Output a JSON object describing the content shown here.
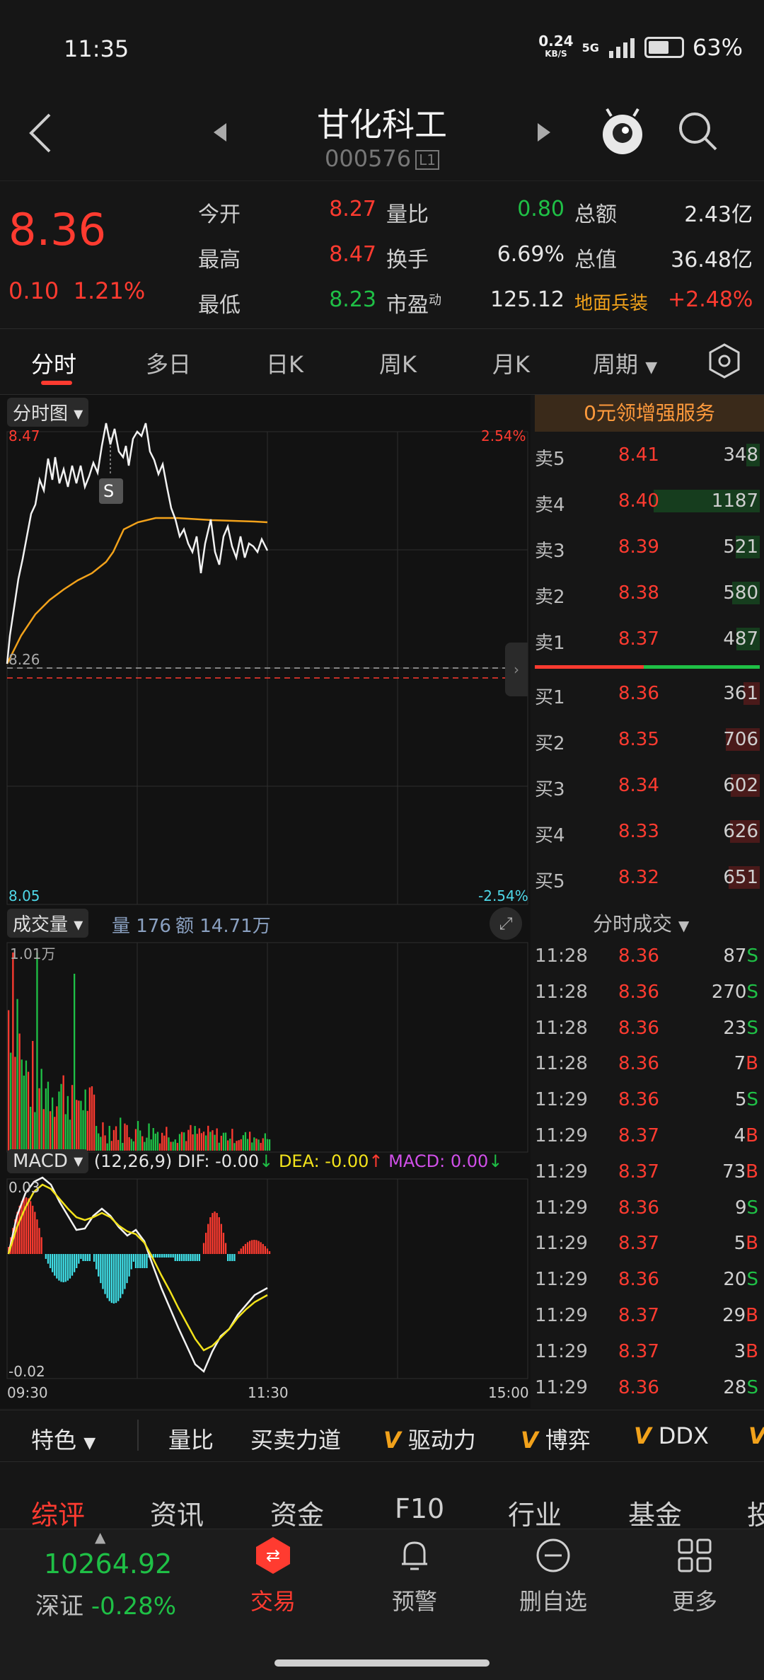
{
  "status": {
    "time": "11:35",
    "net_speed_top": "0.24",
    "net_speed_unit": "KB/S",
    "network": "5G",
    "battery": "63%",
    "battery_level": 0.63
  },
  "header": {
    "name": "甘化科工",
    "code": "000576",
    "level": "L1"
  },
  "quote": {
    "price": "8.36",
    "change": "0.10",
    "change_pct": "1.21%",
    "open_label": "今开",
    "open": "8.27",
    "high_label": "最高",
    "high": "8.47",
    "low_label": "最低",
    "low": "8.23",
    "vr_label": "量比",
    "vr": "0.80",
    "turnover_label": "换手",
    "turnover": "6.69%",
    "pe_label": "市盈",
    "pe_sup": "动",
    "pe": "125.12",
    "amount_label": "总额",
    "amount": "2.43亿",
    "mcap_label": "总值",
    "mcap": "36.48亿",
    "sector": "地面兵装",
    "sector_change": "+2.48%"
  },
  "tabs": [
    "分时",
    "多日",
    "日K",
    "周K",
    "月K",
    "周期"
  ],
  "chart": {
    "main_label": "分时图",
    "price_high": "8.47",
    "price_low": "8.05",
    "pct_high": "2.54%",
    "pct_low": "-2.54%",
    "ref_label": "8.26",
    "marker": "S",
    "vol_label": "成交量",
    "vol_text": "量 176",
    "amt_text": "额 14.71万",
    "vol_max": "1.01万",
    "macd_label": "MACD",
    "macd_params": "(12,26,9)",
    "dif": "DIF: -0.00",
    "dea": "DEA: -0.00",
    "macd": "MACD: 0.00",
    "macd_high": "0.03",
    "macd_low": "-0.02",
    "time_start": "09:30",
    "time_mid": "11:30",
    "time_end": "15:00"
  },
  "orderbook": {
    "banner": "0元领增强服务",
    "asks": [
      {
        "label": "卖5",
        "price": "8.41",
        "vol": "348",
        "frac": 0.12
      },
      {
        "label": "卖4",
        "price": "8.40",
        "vol": "1187",
        "frac": 0.96
      },
      {
        "label": "卖3",
        "price": "8.39",
        "vol": "521",
        "frac": 0.22
      },
      {
        "label": "卖2",
        "price": "8.38",
        "vol": "580",
        "frac": 0.25
      },
      {
        "label": "卖1",
        "price": "8.37",
        "vol": "487",
        "frac": 0.21
      }
    ],
    "bids": [
      {
        "label": "买1",
        "price": "8.36",
        "vol": "361",
        "frac": 0.15
      },
      {
        "label": "买2",
        "price": "8.35",
        "vol": "706",
        "frac": 0.31
      },
      {
        "label": "买3",
        "price": "8.34",
        "vol": "602",
        "frac": 0.26
      },
      {
        "label": "买4",
        "price": "8.33",
        "vol": "626",
        "frac": 0.27
      },
      {
        "label": "买5",
        "price": "8.32",
        "vol": "651",
        "frac": 0.28
      }
    ]
  },
  "ticks": {
    "title": "分时成交",
    "rows": [
      {
        "time": "11:28",
        "price": "8.36",
        "vol": "87",
        "side": "S"
      },
      {
        "time": "11:28",
        "price": "8.36",
        "vol": "270",
        "side": "S"
      },
      {
        "time": "11:28",
        "price": "8.36",
        "vol": "23",
        "side": "S"
      },
      {
        "time": "11:28",
        "price": "8.36",
        "vol": "7",
        "side": "B"
      },
      {
        "time": "11:29",
        "price": "8.36",
        "vol": "5",
        "side": "S"
      },
      {
        "time": "11:29",
        "price": "8.37",
        "vol": "4",
        "side": "B"
      },
      {
        "time": "11:29",
        "price": "8.37",
        "vol": "73",
        "side": "B"
      },
      {
        "time": "11:29",
        "price": "8.36",
        "vol": "9",
        "side": "S"
      },
      {
        "time": "11:29",
        "price": "8.37",
        "vol": "5",
        "side": "B"
      },
      {
        "time": "11:29",
        "price": "8.36",
        "vol": "20",
        "side": "S"
      },
      {
        "time": "11:29",
        "price": "8.37",
        "vol": "29",
        "side": "B"
      },
      {
        "time": "11:29",
        "price": "8.37",
        "vol": "3",
        "side": "B"
      },
      {
        "time": "11:29",
        "price": "8.36",
        "vol": "28",
        "side": "S"
      }
    ]
  },
  "features": {
    "special": "特色",
    "items": [
      "量比",
      "买卖力道",
      "驱动力",
      "博弈",
      "DDX"
    ]
  },
  "info_tabs": [
    "综评",
    "资讯",
    "资金",
    "F10",
    "行业",
    "基金",
    "投"
  ],
  "bottom": {
    "index_value": "10264.92",
    "index_name": "深证",
    "index_change": "-0.28%",
    "nav": [
      "交易",
      "预警",
      "删自选",
      "更多"
    ]
  }
}
